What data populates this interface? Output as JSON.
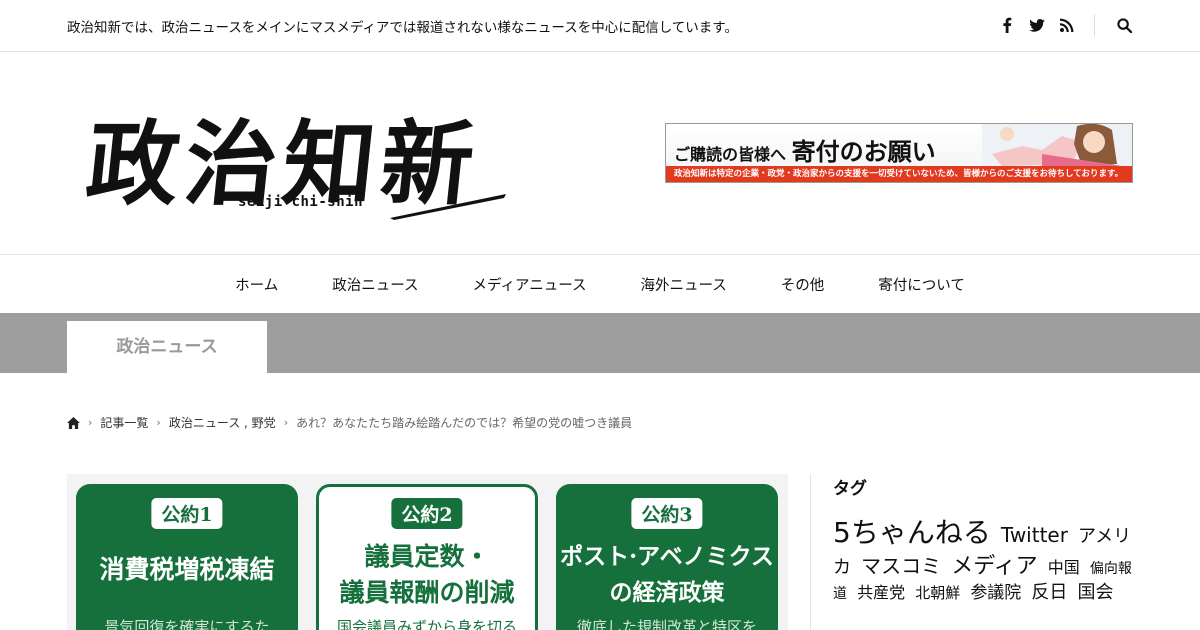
{
  "topbar": {
    "tagline": "政治知新では、政治ニュースをメインにマスメディアでは報道されない様なニュースを中心に配信しています。",
    "icons": [
      "facebook-icon",
      "twitter-icon",
      "rss-icon",
      "search-icon"
    ]
  },
  "header": {
    "logo_text": "政治知新",
    "logo_sub": "seiji-chi-shin",
    "banner": {
      "line1_small": "ご購読の皆様へ",
      "line1_big": "寄付のお願い",
      "strip": "政治知新は特定の企業・政党・政治家からの支援を一切受けていないため、皆様からのご支援をお待ちしております。",
      "strip_color": "#e23a1e"
    }
  },
  "nav": {
    "items": [
      {
        "label": "ホーム"
      },
      {
        "label": "政治ニュース"
      },
      {
        "label": "メディアニュース"
      },
      {
        "label": "海外ニュース"
      },
      {
        "label": "その他"
      },
      {
        "label": "寄付について"
      }
    ]
  },
  "category": {
    "label": "政治ニュース",
    "band_color": "#9e9e9e"
  },
  "breadcrumb": {
    "items": [
      "記事一覧",
      "政治ニュース , 野党"
    ],
    "current": "あれ？あなたたち踏み絵踏んだのでは？希望の党の嘘つき議員"
  },
  "article_image": {
    "accent": "#15703c",
    "cards": [
      {
        "pledge": "公約1",
        "title": "消費税増税凍結",
        "sub": "景気回復を確実にするた"
      },
      {
        "pledge": "公約2",
        "title": "議員定数・\n議員報酬の削減",
        "sub": "国会議員みずから身を切る"
      },
      {
        "pledge": "公約3",
        "title": "ポスト·アベノミクス\nの経済政策",
        "sub": "徹底した規制改革と特区を"
      }
    ]
  },
  "sidebar": {
    "tags_title": "タグ",
    "tags": [
      {
        "label": "5ちゃんねる",
        "size": 28
      },
      {
        "label": "Twitter",
        "size": 20
      },
      {
        "label": "アメリカ",
        "size": 18
      },
      {
        "label": "マスコミ",
        "size": 20
      },
      {
        "label": "メディア",
        "size": 22
      },
      {
        "label": "中国",
        "size": 16
      },
      {
        "label": "偏向報道",
        "size": 14
      },
      {
        "label": "共産党",
        "size": 16
      },
      {
        "label": "北朝鮮",
        "size": 15
      },
      {
        "label": "参議院",
        "size": 17
      },
      {
        "label": "反日",
        "size": 18
      },
      {
        "label": "国会",
        "size": 18
      }
    ]
  }
}
